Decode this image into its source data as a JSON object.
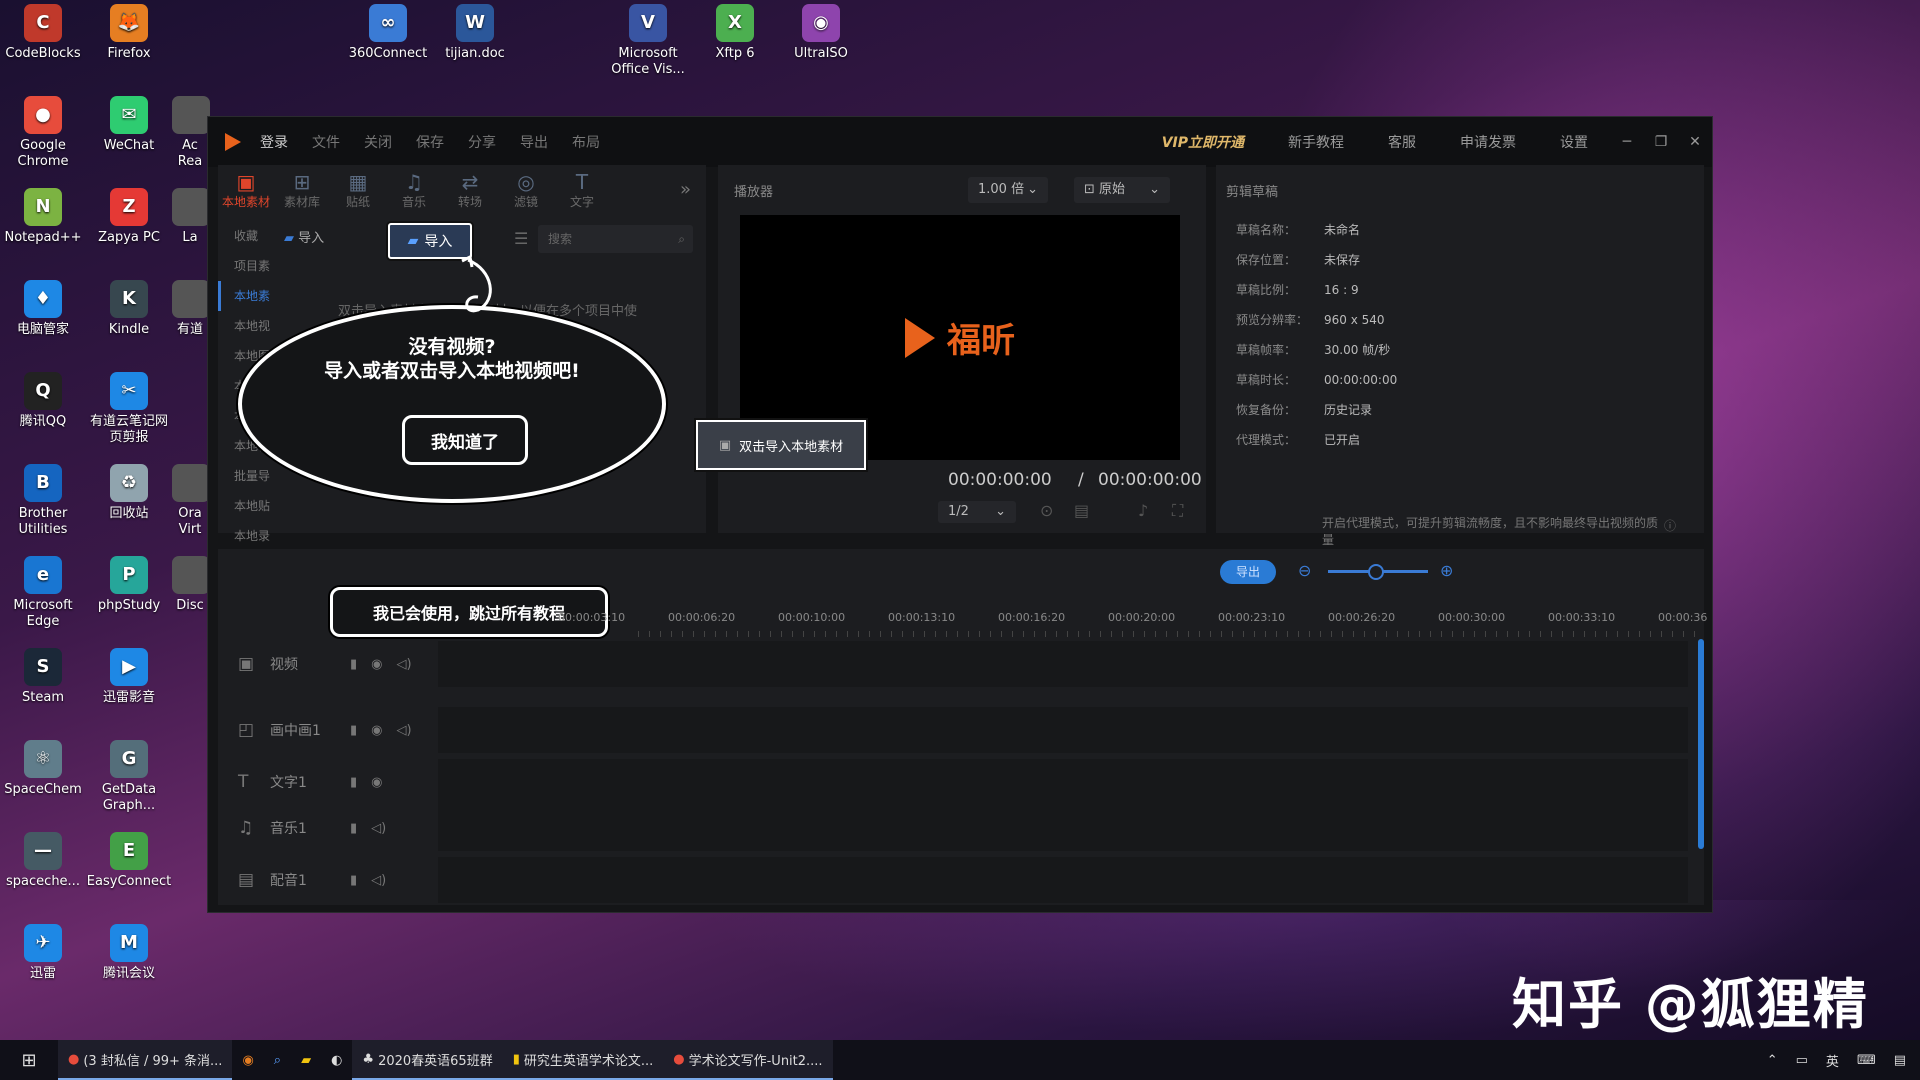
{
  "desktop": {
    "icons": [
      {
        "label": "CodeBlocks",
        "glyph": "C",
        "color": "#c0392b"
      },
      {
        "label": "Firefox",
        "glyph": "🦊",
        "color": "#e67e22"
      },
      {
        "label": "360Connect",
        "glyph": "∞",
        "color": "#3a7bd5"
      },
      {
        "label": "tijian.doc",
        "glyph": "W",
        "color": "#2b579a"
      },
      {
        "label": "Microsoft Office Vis...",
        "glyph": "V",
        "color": "#3955a3"
      },
      {
        "label": "Xftp 6",
        "glyph": "X",
        "color": "#4caf50"
      },
      {
        "label": "UltraISO",
        "glyph": "◉",
        "color": "#8e44ad"
      },
      {
        "label": "Google Chrome",
        "glyph": "●",
        "color": "#e74c3c"
      },
      {
        "label": "WeChat",
        "glyph": "✉",
        "color": "#2ecc71"
      },
      {
        "label": "Notepad++",
        "glyph": "N",
        "color": "#7cb342"
      },
      {
        "label": "Zapya PC",
        "glyph": "Z",
        "color": "#e53935"
      },
      {
        "label": "电脑管家",
        "glyph": "♦",
        "color": "#1e88e5"
      },
      {
        "label": "Kindle",
        "glyph": "K",
        "color": "#37474f"
      },
      {
        "label": "腾讯QQ",
        "glyph": "Q",
        "color": "#222"
      },
      {
        "label": "有道云笔记网页剪报",
        "glyph": "✂",
        "color": "#1e88e5"
      },
      {
        "label": "Brother Utilities",
        "glyph": "B",
        "color": "#1565c0"
      },
      {
        "label": "回收站",
        "glyph": "♻",
        "color": "#90a4ae"
      },
      {
        "label": "Microsoft Edge",
        "glyph": "e",
        "color": "#1976d2"
      },
      {
        "label": "phpStudy",
        "glyph": "P",
        "color": "#26a69a"
      },
      {
        "label": "Steam",
        "glyph": "S",
        "color": "#1b2838"
      },
      {
        "label": "迅雷影音",
        "glyph": "▶",
        "color": "#1e88e5"
      },
      {
        "label": "SpaceChem",
        "glyph": "⚛",
        "color": "#607d8b"
      },
      {
        "label": "GetData Graph...",
        "glyph": "G",
        "color": "#546e7a"
      },
      {
        "label": "spaceche...",
        "glyph": "—",
        "color": "#455a64"
      },
      {
        "label": "EasyConnect",
        "glyph": "E",
        "color": "#43a047"
      },
      {
        "label": "迅雷",
        "glyph": "✈",
        "color": "#1e88e5"
      },
      {
        "label": "腾讯会议",
        "glyph": "M",
        "color": "#1e88e5"
      }
    ],
    "partial_icons": [
      "Ac Rea",
      "La",
      "有道",
      "Ora Virt",
      "Disc"
    ]
  },
  "app": {
    "title_menu": [
      "登录",
      "文件",
      "关闭",
      "保存",
      "分享",
      "导出",
      "布局"
    ],
    "title_right": {
      "vip": "VIP立即开通",
      "tutorial": "新手教程",
      "service": "客服",
      "invoice": "申请发票",
      "settings": "设置"
    },
    "tool_tabs": [
      {
        "label": "本地素材",
        "icon": "folder-icon",
        "glyph": "▣"
      },
      {
        "label": "素材库",
        "icon": "library-icon",
        "glyph": "⊞"
      },
      {
        "label": "贴纸",
        "icon": "sticker-icon",
        "glyph": "▦"
      },
      {
        "label": "音乐",
        "icon": "music-icon",
        "glyph": "♫"
      },
      {
        "label": "转场",
        "icon": "transition-icon",
        "glyph": "⇄"
      },
      {
        "label": "滤镜",
        "icon": "filter-icon",
        "glyph": "◎"
      },
      {
        "label": "文字",
        "icon": "text-icon",
        "glyph": "T"
      }
    ],
    "left_nav": [
      "收藏",
      "项目素",
      "本地素",
      "本地视",
      "本地图",
      "本地音",
      "本地字",
      "本地视",
      "批量导",
      "本地贴",
      "本地录"
    ],
    "import_small": "导入",
    "import_button": "导入",
    "search_placeholder": "搜索",
    "hint_text": "双击导入素材文件到本地素材，以便在多个项目中使",
    "bubble": {
      "line1": "没有视频?",
      "line2": "导入或者双击导入本地视频吧!",
      "gotit": "我知道了"
    },
    "player": {
      "title": "播放器",
      "speed": "1.00 倍",
      "ratio": "原始",
      "brand": "福昕",
      "double_click_import": "双击导入本地素材",
      "timecode": "00:00:00:00",
      "separator": "/",
      "duration": "00:00:00:00",
      "scale": "1/2"
    },
    "props": {
      "title": "剪辑草稿",
      "rows": [
        {
          "k": "草稿名称：",
          "v": "未命名"
        },
        {
          "k": "保存位置：",
          "v": "未保存"
        },
        {
          "k": "草稿比例：",
          "v": "16 : 9"
        },
        {
          "k": "预览分辨率：",
          "v": "960 x 540"
        },
        {
          "k": "草稿帧率：",
          "v": "30.00 帧/秒"
        },
        {
          "k": "草稿时长：",
          "v": "00:00:00:00"
        },
        {
          "k": "恢复备份：",
          "v": "历史记录"
        },
        {
          "k": "代理模式：",
          "v": "已开启"
        }
      ],
      "note": "开启代理模式，可提升剪辑流畅度，且不影响最终导出视频的质量"
    },
    "timeline": {
      "export": "导出",
      "skip_tutorial": "我已会使用，跳过所有教程",
      "ruler": [
        "00:00:03:10",
        "00:00:06:20",
        "00:00:10:00",
        "00:00:13:10",
        "00:00:16:20",
        "00:00:20:00",
        "00:00:23:10",
        "00:00:26:20",
        "00:00:30:00",
        "00:00:33:10",
        "00:00:36"
      ],
      "tracks": [
        {
          "name": "视频",
          "icon": "film-icon",
          "glyph": "▣"
        },
        {
          "name": "画中画1",
          "icon": "pip-icon",
          "glyph": "◰"
        },
        {
          "name": "文字1",
          "icon": "text-track-icon",
          "glyph": "T"
        },
        {
          "name": "音乐1",
          "icon": "music-track-icon",
          "glyph": "♫"
        },
        {
          "name": "配音1",
          "icon": "voice-track-icon",
          "glyph": "▤"
        }
      ]
    }
  },
  "taskbar": {
    "items": [
      "(3 封私信 / 99+ 条消...",
      "2020春英语65班群",
      "研究生英语学术论文...",
      "学术论文写作-Unit2...."
    ],
    "tray": {
      "lang": "英"
    }
  },
  "watermark": "知乎 @狐狸精"
}
